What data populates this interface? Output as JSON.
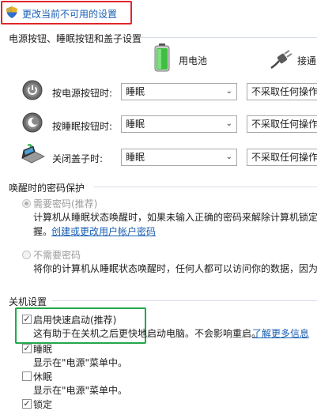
{
  "header": {
    "change_link": "更改当前不可用的设置"
  },
  "power_buttons": {
    "section_title": "电源按钮、睡眠按钮和盖子设置",
    "battery_label": "用电池",
    "plugged_label": "接通",
    "rows": [
      {
        "label": "按电源按钮时:",
        "battery_value": "睡眠",
        "plugged_value": "不采取任何操作"
      },
      {
        "label": "按睡眠按钮时:",
        "battery_value": "睡眠",
        "plugged_value": "不采取任何操作"
      },
      {
        "label": "关闭盖子时:",
        "battery_value": "睡眠",
        "plugged_value": "不采取任何操作"
      }
    ]
  },
  "password": {
    "section_title": "唤醒时的密码保护",
    "require": {
      "label": "需要密码(推荐)",
      "desc_line1": "计算机从睡眠状态唤醒时，如果未输入正确的密码来解除计算机锁定，",
      "desc_line2_prefix": "握。",
      "desc_link": "创建或更改用户帐户密码"
    },
    "no_require": {
      "label": "不需要密码",
      "desc": "将你的计算机从睡眠状态唤醒时，任何人都可以访问你的数据，因为计"
    }
  },
  "shutdown": {
    "section_title": "关机设置",
    "fast_startup": {
      "label": "启用快速启动(推荐)",
      "desc": "这有助于在关机之后更快地启动电脑。不会影响重启。",
      "link": "了解更多信息",
      "checked": true
    },
    "sleep": {
      "label": "睡眠",
      "desc": "显示在\"电源\"菜单中。",
      "checked": true
    },
    "hibernate": {
      "label": "休眠",
      "desc": "显示在\"电源\"菜单中。",
      "checked": false
    },
    "lock": {
      "label": "锁定",
      "checked": true
    }
  },
  "colors": {
    "link": "#1a5fb4",
    "highlight_red": "#e0262b",
    "highlight_green": "#22a84a"
  }
}
